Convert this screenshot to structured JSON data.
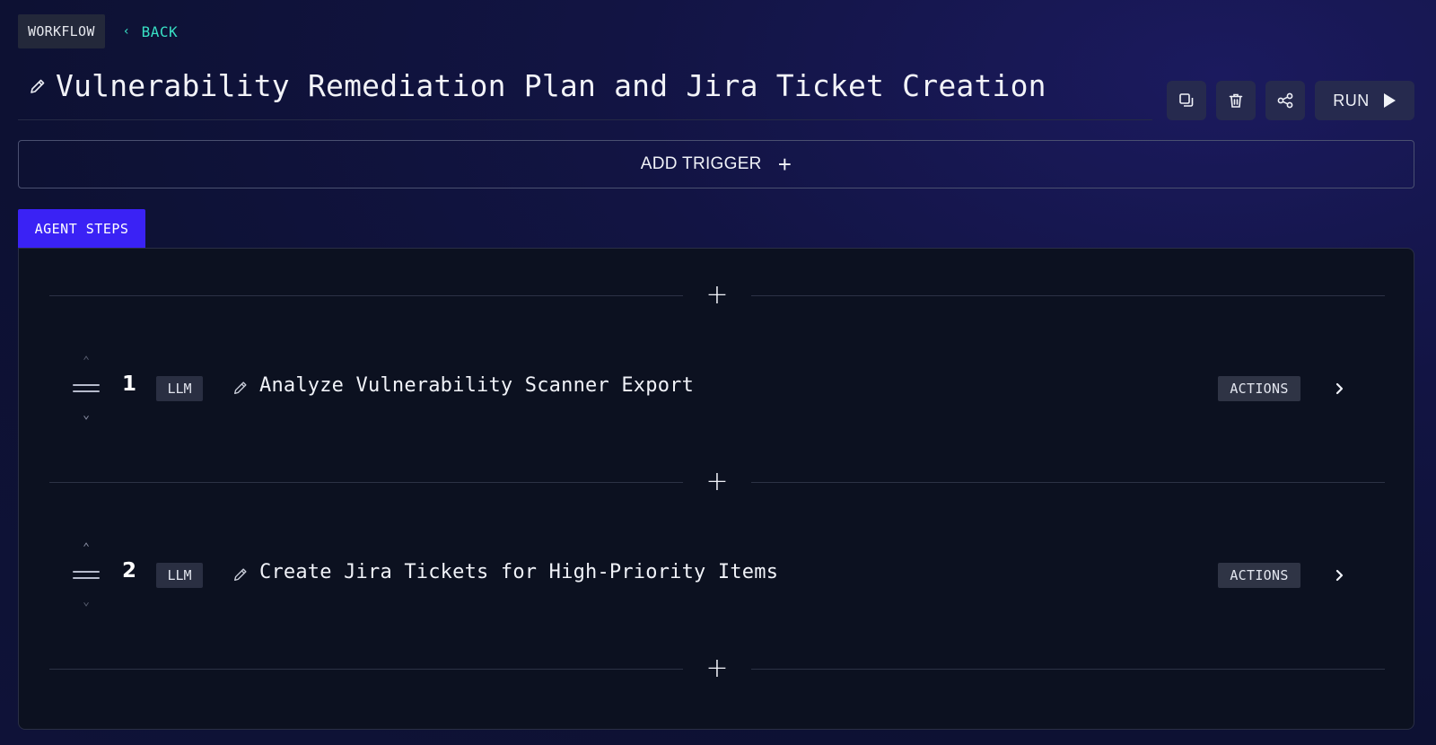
{
  "header": {
    "workflow_tag": "WORKFLOW",
    "back_label": "BACK",
    "back_chevron": "‹",
    "title": "Vulnerability Remediation Plan and Jira Ticket Creation"
  },
  "toolbar": {
    "run_label": "RUN",
    "icons": [
      "copy-icon",
      "trash-icon",
      "share-icon",
      "play-icon"
    ]
  },
  "trigger": {
    "label": "ADD TRIGGER",
    "icon": "+"
  },
  "steps_section": {
    "tab_label": "AGENT STEPS",
    "insert_icon": "+",
    "steps": [
      {
        "number": "1",
        "type": "LLM",
        "name": "Analyze Vulnerability Scanner Export",
        "actions_label": "ACTIONS"
      },
      {
        "number": "2",
        "type": "LLM",
        "name": "Create Jira Tickets for High-Priority Items",
        "actions_label": "ACTIONS"
      }
    ]
  },
  "colors": {
    "accent": "#3a22f5",
    "back_link": "#38e0c4",
    "panel_bg": "#0c1120",
    "button_bg": "#262a4e"
  }
}
